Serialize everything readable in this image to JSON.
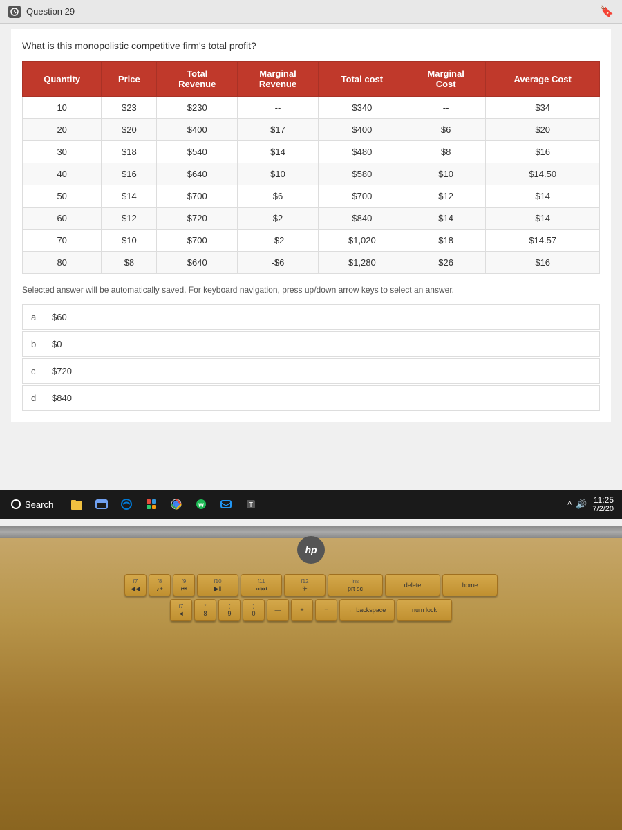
{
  "window": {
    "title": "Question 29",
    "bookmark_icon": "🔖"
  },
  "question": {
    "text": "What is this monopolistic competitive firm's total profit?"
  },
  "table": {
    "headers": [
      "Quantity",
      "Price",
      "Total Revenue",
      "Marginal Revenue",
      "Total cost",
      "Marginal Cost",
      "Average Cost"
    ],
    "rows": [
      {
        "quantity": "10",
        "price": "$23",
        "total_revenue": "$230",
        "marginal_revenue": "--",
        "total_cost": "$340",
        "marginal_cost": "--",
        "average_cost": "$34"
      },
      {
        "quantity": "20",
        "price": "$20",
        "total_revenue": "$400",
        "marginal_revenue": "$17",
        "total_cost": "$400",
        "marginal_cost": "$6",
        "average_cost": "$20"
      },
      {
        "quantity": "30",
        "price": "$18",
        "total_revenue": "$540",
        "marginal_revenue": "$14",
        "total_cost": "$480",
        "marginal_cost": "$8",
        "average_cost": "$16"
      },
      {
        "quantity": "40",
        "price": "$16",
        "total_revenue": "$640",
        "marginal_revenue": "$10",
        "total_cost": "$580",
        "marginal_cost": "$10",
        "average_cost": "$14.50"
      },
      {
        "quantity": "50",
        "price": "$14",
        "total_revenue": "$700",
        "marginal_revenue": "$6",
        "total_cost": "$700",
        "marginal_cost": "$12",
        "average_cost": "$14"
      },
      {
        "quantity": "60",
        "price": "$12",
        "total_revenue": "$720",
        "marginal_revenue": "$2",
        "total_cost": "$840",
        "marginal_cost": "$14",
        "average_cost": "$14"
      },
      {
        "quantity": "70",
        "price": "$10",
        "total_revenue": "$700",
        "marginal_revenue": "-$2",
        "total_cost": "$1,020",
        "marginal_cost": "$18",
        "average_cost": "$14.57"
      },
      {
        "quantity": "80",
        "price": "$8",
        "total_revenue": "$640",
        "marginal_revenue": "-$6",
        "total_cost": "$1,280",
        "marginal_cost": "$26",
        "average_cost": "$16"
      }
    ]
  },
  "instruction": "Selected answer will be automatically saved. For keyboard navigation, press up/down arrow keys to select an answer.",
  "answers": [
    {
      "letter": "a",
      "value": "$60"
    },
    {
      "letter": "b",
      "value": "$0"
    },
    {
      "letter": "c",
      "value": "$720"
    },
    {
      "letter": "d",
      "value": "$840"
    }
  ],
  "taskbar": {
    "search_label": "Search",
    "time": "11:25",
    "date": "7/2/20"
  },
  "keyboard": {
    "hp_label": "hp"
  }
}
